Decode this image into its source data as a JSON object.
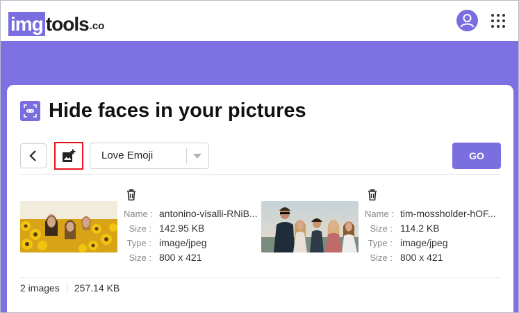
{
  "header": {
    "logo": {
      "img": "img",
      "tools": "tools",
      "tld": ".co"
    },
    "icons": {
      "account": "account-circle-icon",
      "apps": "apps-grid-icon"
    }
  },
  "page": {
    "title": "Hide faces in your pictures",
    "title_icon": "face-mask-icon"
  },
  "toolbar": {
    "back_icon": "chevron-left-icon",
    "add_icon": "add-photo-icon",
    "emoji_select": {
      "value": "Love Emoji"
    },
    "go_label": "GO"
  },
  "files": [
    {
      "labels": {
        "name": "Name :",
        "size": "Size :",
        "type": "Type :",
        "dims": "Size :"
      },
      "name": "antonino-visalli-RNiB...",
      "size": "142.95 KB",
      "type": "image/jpeg",
      "dimensions": "800 x 421"
    },
    {
      "labels": {
        "name": "Name :",
        "size": "Size :",
        "type": "Type :",
        "dims": "Size :"
      },
      "name": "tim-mossholder-hOF...",
      "size": "114.2 KB",
      "type": "image/jpeg",
      "dimensions": "800 x 421"
    }
  ],
  "summary": {
    "count": "2 images",
    "total_size": "257.14 KB"
  },
  "colors": {
    "accent": "#7b6fe0",
    "band": "#7c70e2",
    "highlight": "#e8121b"
  }
}
